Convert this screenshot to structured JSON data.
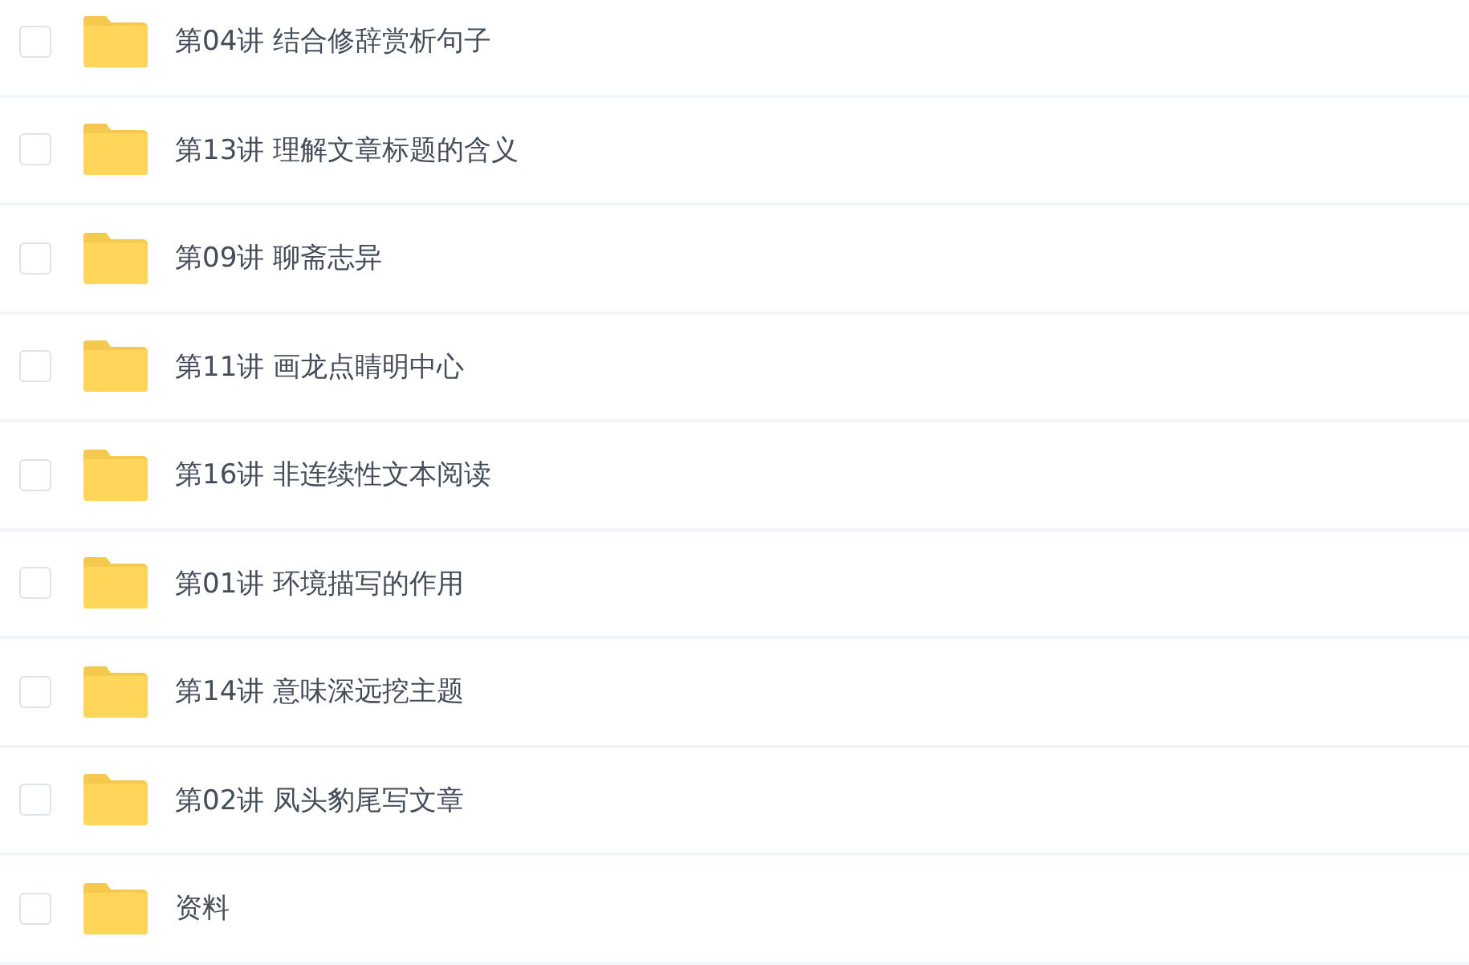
{
  "files": [
    {
      "name": "第04讲 结合修辞赏析句子",
      "checked": false
    },
    {
      "name": "第13讲 理解文章标题的含义",
      "checked": false
    },
    {
      "name": "第09讲 聊斋志异",
      "checked": false
    },
    {
      "name": "第11讲 画龙点睛明中心",
      "checked": false
    },
    {
      "name": "第16讲 非连续性文本阅读",
      "checked": false
    },
    {
      "name": "第01讲 环境描写的作用",
      "checked": false
    },
    {
      "name": "第14讲 意味深远挖主题",
      "checked": false
    },
    {
      "name": "第02讲 凤头豹尾写文章",
      "checked": false
    },
    {
      "name": "资料",
      "checked": false
    }
  ]
}
